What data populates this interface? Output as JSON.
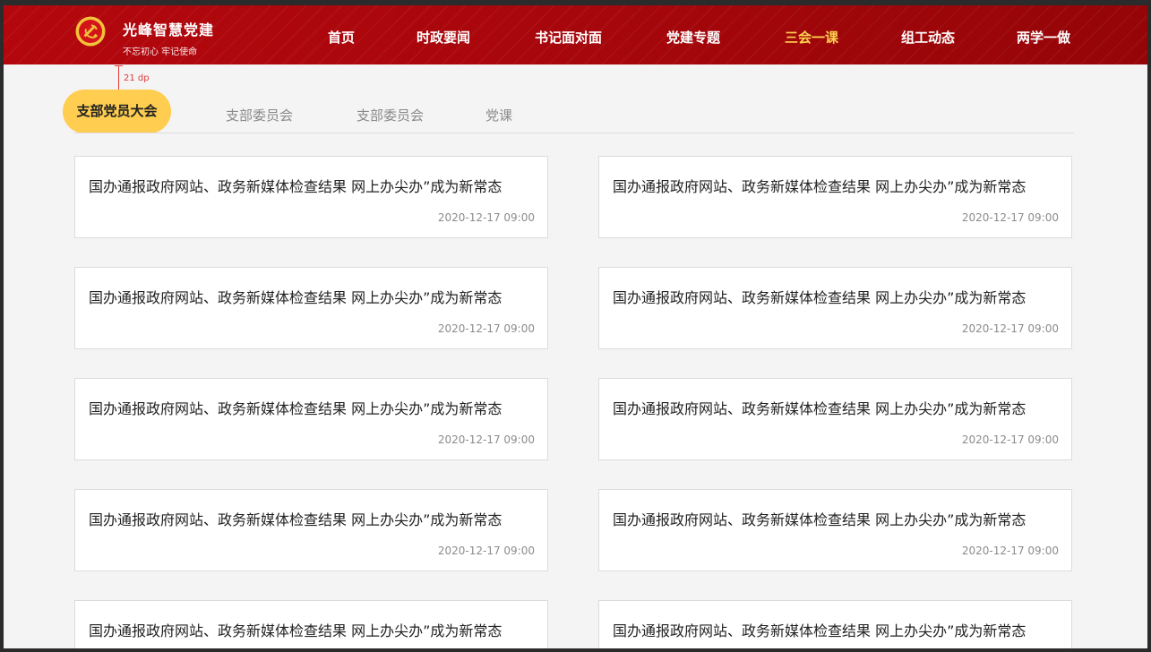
{
  "header": {
    "brand_title": "光峰智慧党建",
    "brand_slogan": "不忘初心 牢记使命",
    "colors": {
      "primary": "#b3070d",
      "active_nav": "#ffd24d",
      "active_tab": "#ffcd4f"
    },
    "logo_icon": "party-emblem-icon",
    "nav": [
      {
        "label": "首页",
        "active": false
      },
      {
        "label": "时政要闻",
        "active": false
      },
      {
        "label": "书记面对面",
        "active": false
      },
      {
        "label": "党建专题",
        "active": false
      },
      {
        "label": "三会一课",
        "active": true
      },
      {
        "label": "组工动态",
        "active": false
      },
      {
        "label": "两学一做",
        "active": false
      }
    ]
  },
  "annotation": {
    "spacing_label": "21 dp"
  },
  "subtabs": [
    {
      "label": "支部党员大会",
      "active": true
    },
    {
      "label": "支部委员会",
      "active": false
    },
    {
      "label": "支部委员会",
      "active": false
    },
    {
      "label": "党课",
      "active": false
    }
  ],
  "articles": [
    {
      "title": "国办通报政府网站、政务新媒体检查结果 网上办尖办”成为新常态",
      "date": "2020-12-17 09:00"
    },
    {
      "title": "国办通报政府网站、政务新媒体检查结果 网上办尖办”成为新常态",
      "date": "2020-12-17 09:00"
    },
    {
      "title": "国办通报政府网站、政务新媒体检查结果 网上办尖办”成为新常态",
      "date": "2020-12-17 09:00"
    },
    {
      "title": "国办通报政府网站、政务新媒体检查结果 网上办尖办”成为新常态",
      "date": "2020-12-17 09:00"
    },
    {
      "title": "国办通报政府网站、政务新媒体检查结果 网上办尖办”成为新常态",
      "date": "2020-12-17 09:00"
    },
    {
      "title": "国办通报政府网站、政务新媒体检查结果 网上办尖办”成为新常态",
      "date": "2020-12-17 09:00"
    },
    {
      "title": "国办通报政府网站、政务新媒体检查结果 网上办尖办”成为新常态",
      "date": "2020-12-17 09:00"
    },
    {
      "title": "国办通报政府网站、政务新媒体检查结果 网上办尖办”成为新常态",
      "date": "2020-12-17 09:00"
    },
    {
      "title": "国办通报政府网站、政务新媒体检查结果 网上办尖办”成为新常态",
      "date": ""
    },
    {
      "title": "国办通报政府网站、政务新媒体检查结果 网上办尖办”成为新常态",
      "date": ""
    }
  ]
}
